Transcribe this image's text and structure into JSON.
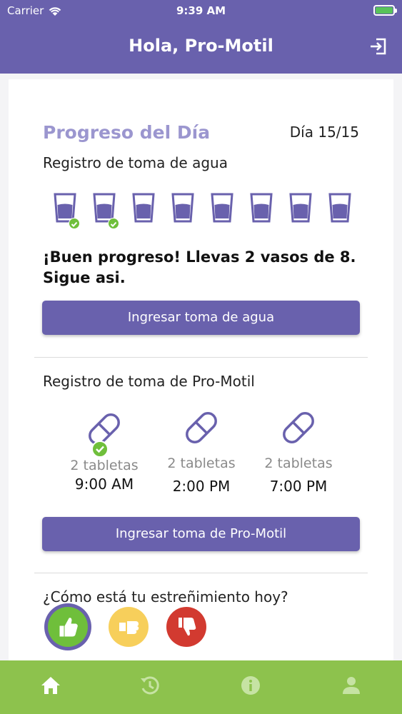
{
  "status_bar": {
    "carrier": "Carrier",
    "time": "9:39 AM"
  },
  "header": {
    "title": "Hola, Pro-Motil"
  },
  "progress": {
    "title": "Progreso del Día",
    "day_label": "Día 15/15",
    "water": {
      "label": "Registro de toma de agua",
      "glasses_total": 8,
      "glasses_done": 2,
      "message": "¡Buen progreso! Llevas 2 vasos de 8. Sigue asi.",
      "button": "Ingresar toma de agua"
    },
    "promotil": {
      "label": "Registro de toma de Pro-Motil",
      "doses": [
        {
          "amount": "2 tabletas",
          "time": "9:00 AM",
          "taken": true
        },
        {
          "amount": "2 tabletas",
          "time": "2:00 PM",
          "taken": false
        },
        {
          "amount": "2 tabletas",
          "time": "7:00 PM",
          "taken": false
        }
      ],
      "button": "Ingresar toma de Pro-Motil"
    },
    "constipation": {
      "question": "¿Cómo está tu estreñimiento hoy?",
      "options": [
        "good",
        "neutral",
        "bad"
      ],
      "selected": "good"
    }
  },
  "colors": {
    "primary": "#6961ad",
    "accent_title": "#9b96cf",
    "tabbar": "#8dc24d",
    "check": "#6fbf3b",
    "good": "#6fbf3b",
    "neutral": "#f7cf5b",
    "bad": "#d23a30"
  },
  "tabbar": {
    "items": [
      "home-icon",
      "history-icon",
      "info-icon",
      "profile-icon"
    ]
  }
}
